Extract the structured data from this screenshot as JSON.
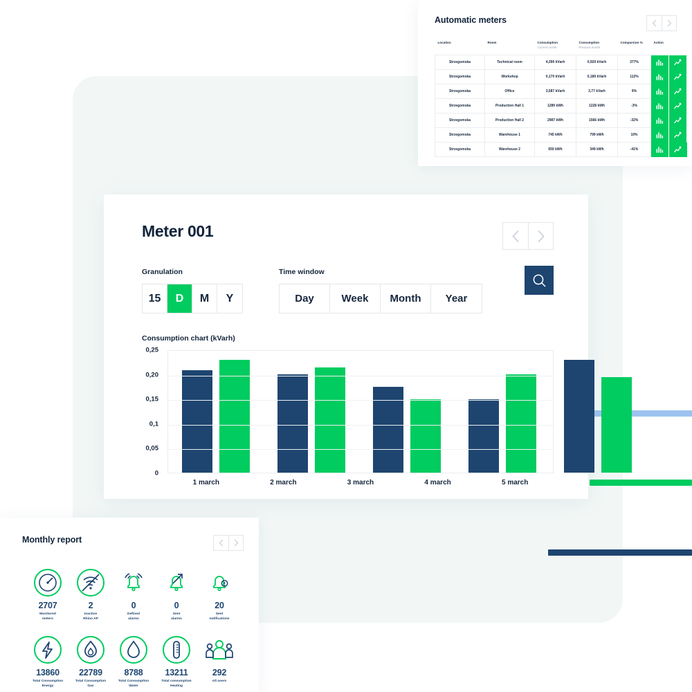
{
  "meters_card": {
    "title": "Automatic meters",
    "pager": {
      "prev": "‹",
      "next": "›"
    },
    "columns": [
      {
        "label": "Location",
        "sub": ""
      },
      {
        "label": "Room",
        "sub": ""
      },
      {
        "label": "Consumption",
        "sub": "Current month"
      },
      {
        "label": "Consumption",
        "sub": "Previous month"
      },
      {
        "label": "Comparsion %",
        "sub": ""
      },
      {
        "label": "Action",
        "sub": ""
      }
    ],
    "rows": [
      {
        "location": "Strzegomska",
        "room": "Technical room",
        "current": "4,390 kVarh",
        "previous": "0,920 kVarh",
        "comparison": "377%"
      },
      {
        "location": "Strzegomska",
        "room": "Workshop",
        "current": "0,170 kVarh",
        "previous": "0,180 kVarh",
        "comparison": "112%"
      },
      {
        "location": "Strzegomska",
        "room": "Office",
        "current": "3,587 kVarh",
        "previous": "3,77 kVarh",
        "comparison": "9%"
      },
      {
        "location": "Strzegomska",
        "room": "Production Hall 1",
        "current": "1289 kWh",
        "previous": "1228 kWh",
        "comparison": "-3%"
      },
      {
        "location": "Strzegomska",
        "room": "Production Hall 2",
        "current": "2987 kWh",
        "previous": "1566 kWh",
        "comparison": "-32%"
      },
      {
        "location": "Strzegomska",
        "room": "Warehouse 1",
        "current": "745 kWh",
        "previous": "799 kWh",
        "comparison": "10%"
      },
      {
        "location": "Strzegomska",
        "room": "Warehouse 2",
        "current": "650 kWh",
        "previous": "349 kWh",
        "comparison": "-41%"
      }
    ],
    "action_icons": [
      "bar-chart-icon",
      "line-chart-icon"
    ]
  },
  "meter_card": {
    "title": "Meter 001",
    "pager": {
      "prev": "‹",
      "next": "›"
    },
    "granulation": {
      "label": "Granulation",
      "options": [
        "15",
        "D",
        "M",
        "Y"
      ],
      "selected": "D"
    },
    "time_window": {
      "label": "Time window",
      "options": [
        "Day",
        "Week",
        "Month",
        "Year"
      ],
      "selected": ""
    },
    "search_icon": "search-icon"
  },
  "chart_data": {
    "type": "bar",
    "title": "Consumption chart (kVarh)",
    "xlabel": "",
    "ylabel": "",
    "ylim": [
      0,
      0.25
    ],
    "grid": true,
    "legend": "none",
    "categories": [
      "1 march",
      "2 march",
      "3 march",
      "4 march",
      "5 march"
    ],
    "ytick_labels": [
      "0,25",
      "0,20",
      "0,15",
      "0,1",
      "0,05",
      "0"
    ],
    "ytick_values": [
      0.25,
      0.2,
      0.15,
      0.1,
      0.05,
      0
    ],
    "series": [
      {
        "name": "series-navy",
        "color": "#1e4570",
        "values": [
          0.208,
          0.199,
          0.174,
          0.149,
          0.229
        ]
      },
      {
        "name": "series-green",
        "color": "#00cc5f",
        "values": [
          0.229,
          0.213,
          0.149,
          0.199,
          0.194
        ]
      }
    ]
  },
  "report_card": {
    "title": "Monthly report",
    "pager": {
      "prev": "‹",
      "next": "›"
    },
    "rows": [
      [
        {
          "icon": "gauge-icon",
          "value": "2707",
          "label": "Monitored\nmeters"
        },
        {
          "icon": "wifi-off-icon",
          "value": "2",
          "label": "Inactive\nRhino AP"
        },
        {
          "icon": "bell-ringing-icon",
          "value": "0",
          "label": "Defined\nalarms"
        },
        {
          "icon": "bell-sent-icon",
          "value": "0",
          "label": "Sent\nalarms"
        },
        {
          "icon": "bell-notification-icon",
          "value": "20",
          "label": "Sent\nnotifications"
        }
      ],
      [
        {
          "icon": "energy-bolt-icon",
          "value": "13860",
          "label": "Total Consumption\nEnergy"
        },
        {
          "icon": "gas-flame-icon",
          "value": "22789",
          "label": "Total Consumption\nGas"
        },
        {
          "icon": "water-drop-icon",
          "value": "8788",
          "label": "Total Consumption\nWater"
        },
        {
          "icon": "thermometer-icon",
          "value": "13211",
          "label": "Total consumption\nHeating"
        },
        {
          "icon": "users-icon",
          "value": "292",
          "label": "All users"
        }
      ]
    ]
  },
  "colors": {
    "navy": "#1e4570",
    "green": "#00cc5f",
    "panel_bg": "#f2f7f6",
    "deco_blue": "#9cc3ef",
    "text_dark": "#16263c",
    "muted": "#9aa3ad"
  }
}
